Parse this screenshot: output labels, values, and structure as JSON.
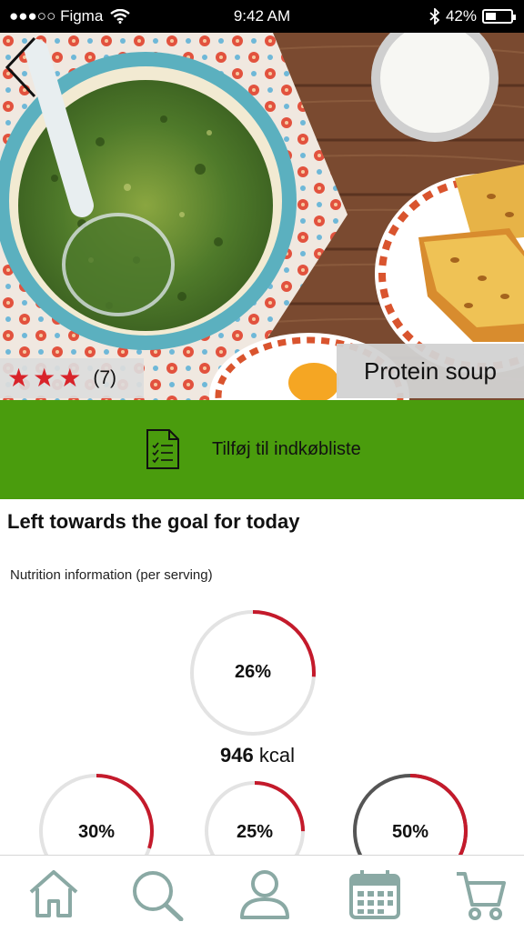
{
  "status_bar": {
    "carrier": "●●●○○ Figma",
    "time": "9:42 AM",
    "battery": "42%"
  },
  "recipe": {
    "title": "Protein soup",
    "rating_stars": 3,
    "rating_count": "(7)"
  },
  "actions": {
    "add_to_list_label": "Tilføj til indkøbliste"
  },
  "goal": {
    "heading": "Left towards the goal for today",
    "subheading": "Nutrition information (per serving)",
    "main": {
      "percent": "26%",
      "fraction": 0.26,
      "kcal_value": "946",
      "kcal_unit": "kcal"
    },
    "small": [
      {
        "percent": "30%",
        "fraction": 0.3
      },
      {
        "percent": "25%",
        "fraction": 0.25
      },
      {
        "percent": "50%",
        "fraction": 0.5
      }
    ]
  },
  "tabs": [
    {
      "icon": "home-icon"
    },
    {
      "icon": "search-icon"
    },
    {
      "icon": "profile-icon"
    },
    {
      "icon": "calendar-icon"
    },
    {
      "icon": "cart-icon"
    }
  ],
  "colors": {
    "accent_green": "#4a9c0d",
    "progress_red": "#c41a2b",
    "star_red": "#d8232a",
    "tab_icon": "#8aa9a4"
  }
}
